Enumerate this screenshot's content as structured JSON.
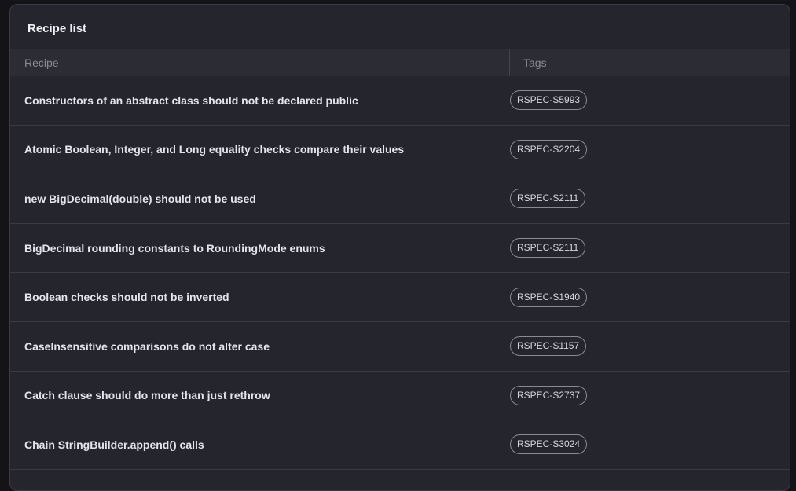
{
  "panel": {
    "title": "Recipe list"
  },
  "table": {
    "columns": [
      "Recipe",
      "Tags"
    ],
    "rows": [
      {
        "recipe": "Constructors of an abstract class should not be declared public",
        "tag": "RSPEC-S5993"
      },
      {
        "recipe": "Atomic Boolean, Integer, and Long equality checks compare their values",
        "tag": "RSPEC-S2204"
      },
      {
        "recipe": "new BigDecimal(double) should not be used",
        "tag": "RSPEC-S2111"
      },
      {
        "recipe": "BigDecimal rounding constants to RoundingMode enums",
        "tag": "RSPEC-S2111"
      },
      {
        "recipe": "Boolean checks should not be inverted",
        "tag": "RSPEC-S1940"
      },
      {
        "recipe": "CaseInsensitive comparisons do not alter case",
        "tag": "RSPEC-S1157"
      },
      {
        "recipe": "Catch clause should do more than just rethrow",
        "tag": "RSPEC-S2737"
      },
      {
        "recipe": "Chain StringBuilder.append() calls",
        "tag": "RSPEC-S3024"
      }
    ]
  }
}
